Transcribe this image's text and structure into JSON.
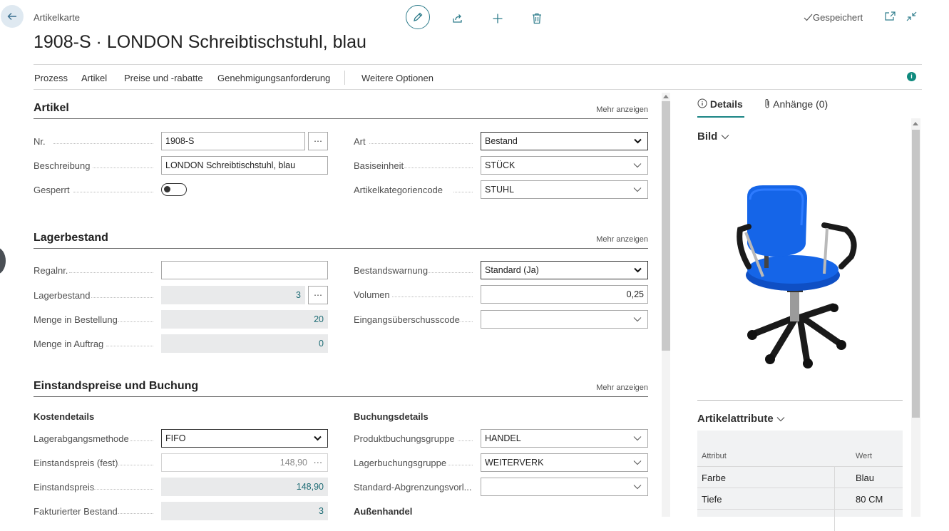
{
  "header": {
    "breadcrumb": "Artikelkarte",
    "title": "1908-S · LONDON Schreibtischstuhl, blau",
    "saved_status": "Gespeichert"
  },
  "menu": [
    "Prozess",
    "Artikel",
    "Preise und -rabatte",
    "Genehmigungsanforderung",
    "Weitere Optionen"
  ],
  "more_label": "Mehr anzeigen",
  "artikel": {
    "title": "Artikel",
    "nr_label": "Nr.",
    "nr_value": "1908-S",
    "beschreibung_label": "Beschreibung",
    "beschreibung_value": "LONDON Schreibtischstuhl, blau",
    "gesperrt_label": "Gesperrt",
    "art_label": "Art",
    "art_value": "Bestand",
    "basiseinheit_label": "Basiseinheit",
    "basiseinheit_value": "STÜCK",
    "kategorie_label": "Artikelkategoriencode",
    "kategorie_value": "STUHL"
  },
  "lager": {
    "title": "Lagerbestand",
    "regal_label": "Regalnr.",
    "regal_value": "",
    "bestand_label": "Lagerbestand",
    "bestand_value": "3",
    "bestellung_label": "Menge in Bestellung",
    "bestellung_value": "20",
    "auftrag_label": "Menge in Auftrag",
    "auftrag_value": "0",
    "warnung_label": "Bestandswarnung",
    "warnung_value": "Standard (Ja)",
    "volumen_label": "Volumen",
    "volumen_value": "0,25",
    "eingang_label": "Eingangsüberschusscode",
    "eingang_value": ""
  },
  "einstand": {
    "title": "Einstandspreise und Buchung",
    "kosten_heading": "Kostendetails",
    "methode_label": "Lagerabgangsmethode",
    "methode_value": "FIFO",
    "fest_label": "Einstandspreis (fest)",
    "fest_value": "148,90",
    "preis_label": "Einstandspreis",
    "preis_value": "148,90",
    "fakt_label": "Fakturierter Bestand",
    "fakt_value": "3",
    "buchung_heading": "Buchungsdetails",
    "produkt_label": "Produktbuchungsgruppe",
    "produkt_value": "HANDEL",
    "lagerbuch_label": "Lagerbuchungsgruppe",
    "lagerbuch_value": "WEITERVERK",
    "abgrenz_label": "Standard-Abgrenzungsvorl...",
    "abgrenz_value": "",
    "aussen_heading": "Außenhandel"
  },
  "factbox": {
    "tab_details": "Details",
    "tab_attachments": "Anhänge (0)",
    "bild_label": "Bild",
    "attr_title": "Artikelattribute",
    "attr_col1": "Attribut",
    "attr_col2": "Wert",
    "rows": [
      {
        "attr": "Farbe",
        "value": "Blau"
      },
      {
        "attr": "Tiefe",
        "value": "80 CM"
      }
    ]
  },
  "colors": {
    "accent": "#1b8585",
    "readonly_bg": "#e9eaeb",
    "chair_blue": "#1565e8"
  }
}
